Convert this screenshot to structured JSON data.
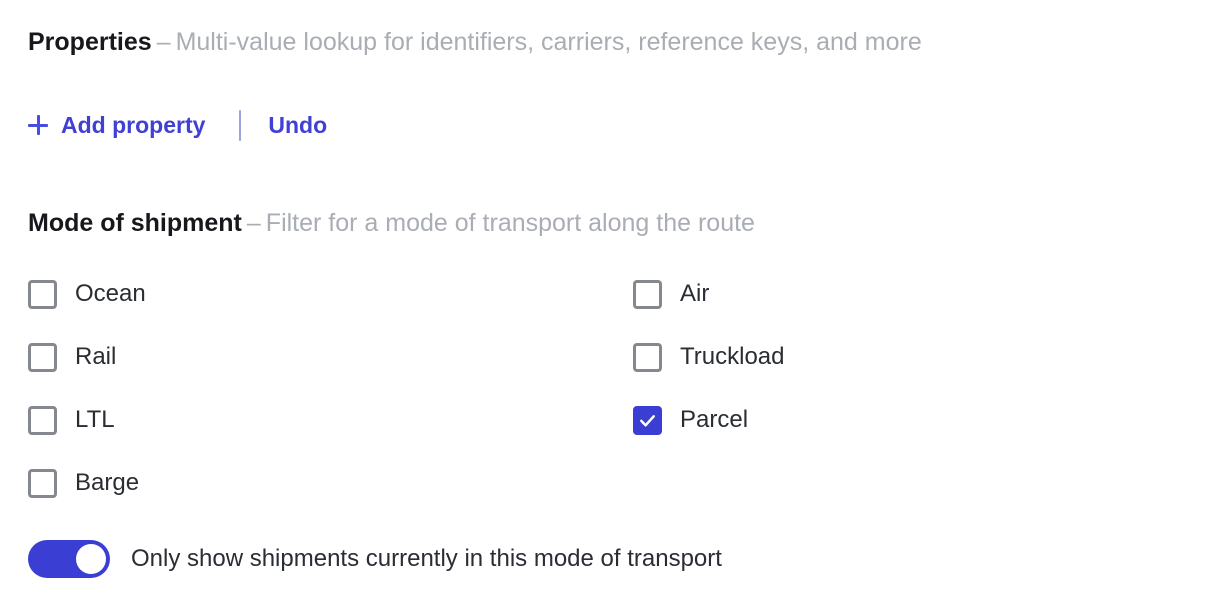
{
  "colors": {
    "accent": "#3a3ed3",
    "link": "#3f40d4",
    "muted_text": "#a9adb4",
    "label_text": "#2a2d33",
    "checkbox_border": "#85888f",
    "divider": "#9ea2e0",
    "background": "#ffffff"
  },
  "properties_section": {
    "title": "Properties",
    "dash": "–",
    "description": "Multi-value lookup for identifiers, carriers, reference keys, and more",
    "actions": {
      "add_property_label": "Add property",
      "add_property_icon": "plus-icon",
      "undo_label": "Undo"
    }
  },
  "mode_section": {
    "title": "Mode of shipment",
    "dash": "–",
    "description": "Filter for a mode of transport along the route",
    "columns": [
      {
        "name": "left",
        "options": [
          {
            "label": "Ocean",
            "checked": false
          },
          {
            "label": "Rail",
            "checked": false
          },
          {
            "label": "LTL",
            "checked": false
          },
          {
            "label": "Barge",
            "checked": false
          }
        ]
      },
      {
        "name": "right",
        "options": [
          {
            "label": "Air",
            "checked": false
          },
          {
            "label": "Truckload",
            "checked": false
          },
          {
            "label": "Parcel",
            "checked": true
          }
        ]
      }
    ],
    "toggle": {
      "label": "Only show shipments currently in this mode of transport",
      "on": true
    }
  }
}
